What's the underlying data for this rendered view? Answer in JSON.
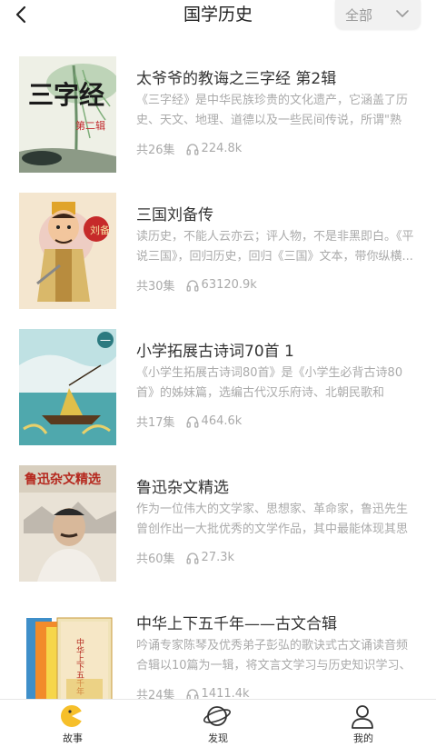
{
  "header": {
    "title": "国学历史",
    "filter_label": "全部"
  },
  "items": [
    {
      "title": "太爷爷的教诲之三字经 第2辑",
      "desc": "《三字经》是中华民族珍贵的文化遗产，它涵盖了历史、天文、地理、道德以及一些民间传说，所谓\"熟读...",
      "episodes": "共26集",
      "plays": "224.8k",
      "cover_text_main": "三字经",
      "cover_text_sub": "第二辑"
    },
    {
      "title": "三国刘备传",
      "desc": "读历史，不能人云亦云；评人物，不是非黑即白。《平说三国》，回归历史，回归《三国》文本，带你纵横...",
      "episodes": "共30集",
      "plays": "63120.9k",
      "cover_text_main": "刘备"
    },
    {
      "title": "小学拓展古诗词70首 1",
      "desc": "《小学生拓展古诗词80首》是《小学生必背古诗80首》的姊妹篇，选编古代汉乐府诗、北朝民歌和唐、...",
      "episodes": "共17集",
      "plays": "464.6k",
      "cover_text_main": "一"
    },
    {
      "title": "鲁迅杂文精选",
      "desc": "作为一位伟大的文学家、思想家、革命家，鲁迅先生曾创作出一大批优秀的文学作品，其中最能体现其思想...",
      "episodes": "共60集",
      "plays": "27.3k",
      "cover_text_main": "鲁迅杂文精选"
    },
    {
      "title": "中华上下五千年——古文合辑",
      "desc": "吟诵专家陈琴及优秀弟子彭弘的歌诀式古文诵读音频合辑以10篇为一辑，将文言文学习与历史知识学习、文...",
      "episodes": "共24集",
      "plays": "1411.4k",
      "cover_text_main": "中华上下五千年"
    }
  ],
  "tabbar": {
    "tabs": [
      {
        "label": "故事",
        "icon": "story-icon"
      },
      {
        "label": "发现",
        "icon": "discover-planet-icon"
      },
      {
        "label": "我的",
        "icon": "profile-icon"
      }
    ]
  },
  "colors": {
    "accent": "#f6bf2a",
    "muted_text": "#aaaaaa",
    "title_text": "#333333",
    "filter_bg": "#f1f1f1"
  }
}
